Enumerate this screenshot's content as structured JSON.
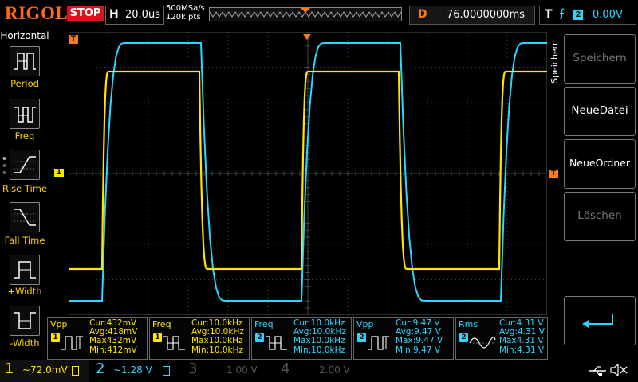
{
  "topbar": {
    "logo": "RIGOL",
    "run_state": "STOP",
    "horizontal_letter": "H",
    "timebase": "20.0us",
    "sample_rate": "500MSa/s",
    "memory_depth": "120k pts",
    "delay_letter": "D",
    "delay": "76.0000000ms",
    "trigger_letter": "T",
    "trigger_source": "2",
    "trigger_level": "0.00V"
  },
  "sidebar": {
    "title": "Horizontal",
    "items": [
      {
        "label": "Period"
      },
      {
        "label": "Freq"
      },
      {
        "label": "Rise Time"
      },
      {
        "label": "Fall Time"
      },
      {
        "label": "+Width"
      },
      {
        "label": "-Width"
      }
    ]
  },
  "markers": {
    "trigger_top": "T",
    "trigger_right": "T",
    "ch1_left": "1"
  },
  "rightmenu": {
    "title": "Speichern",
    "buttons": [
      {
        "label": "Speichern",
        "enabled": false
      },
      {
        "label": "NeueDatei",
        "enabled": true
      },
      {
        "label": "NeueOrdner",
        "enabled": true
      },
      {
        "label": "Löschen",
        "enabled": false
      },
      {
        "label": "",
        "enabled": true,
        "icon": "return-arrow-icon"
      }
    ]
  },
  "measurements": [
    {
      "name": "Vpp",
      "source": "1",
      "cur": "Cur:432mV",
      "avg": "Avg:418mV",
      "max": "Max432mV",
      "min": "Min:412mV",
      "icon": "vpp-icon"
    },
    {
      "name": "Freq",
      "source": "1",
      "cur": "Cur:10.0kHz",
      "avg": "Avg:10.0kHz",
      "max": "Max10.0kHz",
      "min": "Min:10.0kHz",
      "icon": "freq-icon"
    },
    {
      "name": "Freq",
      "source": "2",
      "cur": "Cur:10.0kHz",
      "avg": "Avg:10.0kHz",
      "max": "Max10.0kHz",
      "min": "Min:10.0kHz",
      "icon": "freq-icon"
    },
    {
      "name": "Vpp",
      "source": "2",
      "cur": "Cur:9.47 V",
      "avg": "Avg:9.47 V",
      "max": "Max:9.47 V",
      "min": "Min:9.47 V",
      "icon": "vpp-icon"
    },
    {
      "name": "Rms",
      "source": "2",
      "cur": "Cur:4.31 V",
      "avg": "Avg:4.31 V",
      "max": "Max4.31 V",
      "min": "Min:4.31 V",
      "icon": "rms-icon"
    }
  ],
  "channels": [
    {
      "num": "1",
      "scale": "~72.0mV",
      "color": "#ffe500",
      "active": true
    },
    {
      "num": "2",
      "scale": "~1.28 V",
      "color": "#29d8ff",
      "active": true
    },
    {
      "num": "3",
      "scale": "1.00 V",
      "color": "#555555",
      "active": false
    },
    {
      "num": "4",
      "scale": "2.00 V",
      "color": "#555555",
      "active": false
    }
  ],
  "colors": {
    "ch1": "#ffe500",
    "ch2": "#29d8ff",
    "brand": "#ff6a1a",
    "stop": "#d8141c",
    "grid": "#555555"
  },
  "status_icons": [
    "usb-icon",
    "speaker-muted-icon"
  ]
}
